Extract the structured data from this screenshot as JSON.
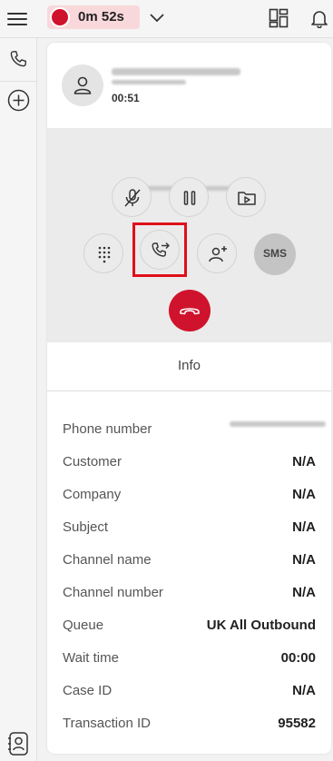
{
  "topbar": {
    "timer": "0m 52s",
    "icons": [
      "menu-icon",
      "record-dot-icon",
      "chevron-down-icon",
      "layout-icon",
      "bell-icon"
    ],
    "recording_color": "#d0132c"
  },
  "rail": {
    "icons": [
      "phone-icon",
      "add-circle-icon",
      "contacts-icon"
    ]
  },
  "call": {
    "duration": "00:51",
    "controls": [
      "mute-icon",
      "pause-icon",
      "media-icon",
      "keypad-icon",
      "transfer-icon",
      "add-participant-icon"
    ],
    "sms_label": "SMS",
    "end_call_color": "#d0132c"
  },
  "tabs": {
    "info_label": "Info"
  },
  "info": {
    "rows": [
      {
        "label": "Phone number",
        "value": ""
      },
      {
        "label": "Customer",
        "value": "N/A"
      },
      {
        "label": "Company",
        "value": "N/A"
      },
      {
        "label": "Subject",
        "value": "N/A"
      },
      {
        "label": "Channel name",
        "value": "N/A"
      },
      {
        "label": "Channel number",
        "value": "N/A"
      },
      {
        "label": "Queue",
        "value": "UK All Outbound"
      },
      {
        "label": "Wait time",
        "value": "00:00"
      },
      {
        "label": "Case ID",
        "value": "N/A"
      },
      {
        "label": "Transaction ID",
        "value": "95582"
      }
    ]
  }
}
